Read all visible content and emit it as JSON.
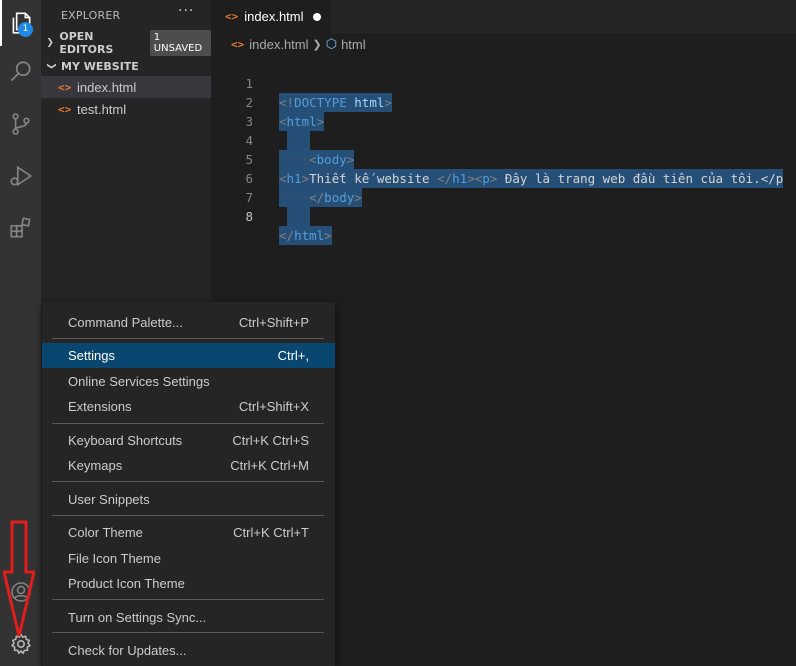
{
  "activity_bar": {
    "explorer_badge": "1",
    "icons": [
      "files-icon",
      "search-icon",
      "source-control-icon",
      "run-debug-icon",
      "extensions-icon",
      "accounts-icon",
      "gear-icon"
    ]
  },
  "sidebar": {
    "title": "EXPLORER",
    "more": "···",
    "open_editors": {
      "label": "OPEN EDITORS",
      "badge": "1 UNSAVED"
    },
    "folder": {
      "label": "MY WEBSITE"
    },
    "files": [
      {
        "name": "index.html",
        "selected": true
      },
      {
        "name": "test.html",
        "selected": false
      }
    ]
  },
  "editor": {
    "tab": {
      "label": "index.html",
      "file_icon": "<>"
    },
    "breadcrumb": {
      "file": "index.html",
      "symbol": "html"
    },
    "current_line": "8",
    "lines": [
      {
        "num": "1",
        "p1": "<!",
        "p2": "DOCTYPE",
        "p3": " html",
        "p4": ">"
      },
      {
        "num": "2",
        "p1": "<",
        "p2": "html",
        "p3": ">"
      },
      {
        "num": "3"
      },
      {
        "num": "4",
        "ws": "····",
        "p1": "<",
        "p2": "body",
        "p3": ">"
      },
      {
        "num": "5",
        "p1": "<",
        "p2": "h1",
        "p3": ">",
        "t1": "Thiết kế website ",
        "p4": "</",
        "p5": "h1",
        "p6": "><",
        "p7": "p",
        "p8": ">",
        "t2": " Đây là trang web đầu tiên của tôi.</p"
      },
      {
        "num": "6",
        "ws": "····",
        "p1": "</",
        "p2": "body",
        "p3": ">"
      },
      {
        "num": "7"
      },
      {
        "num": "8",
        "p1": "</",
        "p2": "html",
        "p3": ">"
      }
    ]
  },
  "menu": {
    "items": [
      {
        "label": "Command Palette...",
        "shortcut": "Ctrl+Shift+P"
      },
      {
        "label": "Settings",
        "shortcut": "Ctrl+,",
        "active": true
      },
      {
        "label": "Online Services Settings",
        "shortcut": ""
      },
      {
        "label": "Extensions",
        "shortcut": "Ctrl+Shift+X"
      },
      {
        "label": "Keyboard Shortcuts",
        "shortcut": "Ctrl+K Ctrl+S"
      },
      {
        "label": "Keymaps",
        "shortcut": "Ctrl+K Ctrl+M"
      },
      {
        "label": "User Snippets",
        "shortcut": ""
      },
      {
        "label": "Color Theme",
        "shortcut": "Ctrl+K Ctrl+T"
      },
      {
        "label": "File Icon Theme",
        "shortcut": ""
      },
      {
        "label": "Product Icon Theme",
        "shortcut": ""
      },
      {
        "label": "Turn on Settings Sync...",
        "shortcut": ""
      },
      {
        "label": "Check for Updates...",
        "shortcut": ""
      }
    ]
  },
  "colors": {
    "accent": "#094771",
    "annotation_arrow": "#e01e1e",
    "html_icon": "#e37933"
  }
}
